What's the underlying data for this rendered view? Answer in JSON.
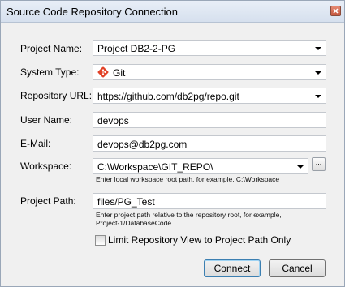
{
  "dialog": {
    "title": "Source Code Repository Connection"
  },
  "form": {
    "project_name": {
      "label": "Project Name:",
      "value": "Project DB2-2-PG"
    },
    "system_type": {
      "label": "System Type:",
      "value": "Git",
      "icon": "git-icon"
    },
    "repository_url": {
      "label": "Repository URL:",
      "value": "https://github.com/db2pg/repo.git"
    },
    "user_name": {
      "label": "User Name:",
      "value": "devops"
    },
    "email": {
      "label": "E-Mail:",
      "value": "devops@db2pg.com"
    },
    "workspace": {
      "label": "Workspace:",
      "value": "C:\\Workspace\\GIT_REPO\\",
      "browse_label": "...",
      "hint": "Enter local workspace root path, for example, C:\\Workspace"
    },
    "project_path": {
      "label": "Project Path:",
      "value": "files/PG_Test",
      "hint_line1": "Enter project path relative to the repository root, for example,",
      "hint_line2": "Project-1/DatabaseCode"
    },
    "limit_view": {
      "label": "Limit Repository View to Project Path Only",
      "checked": false
    }
  },
  "buttons": {
    "connect": "Connect",
    "cancel": "Cancel"
  },
  "colors": {
    "git_brand": "#e24329",
    "dialog_bg": "#f0f0f0",
    "titlebar": "#dbe4f1"
  }
}
